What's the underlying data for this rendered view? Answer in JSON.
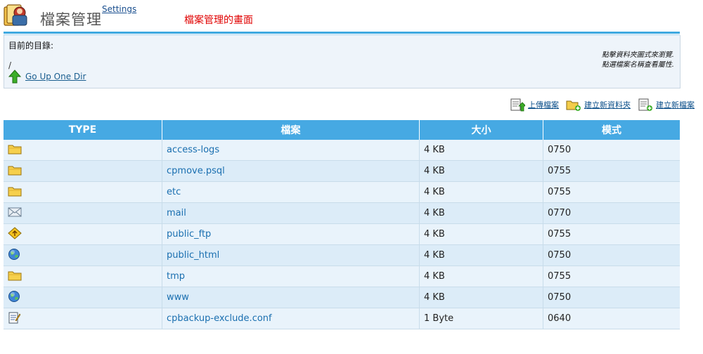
{
  "header": {
    "app_title": "檔案管理",
    "settings_label": "Settings",
    "page_heading": "檔案管理的畫面"
  },
  "dir": {
    "label": "目前的目錄:",
    "path": "/",
    "go_up_label": "Go Up One Dir",
    "hint_line1": "點擊資料夾圖式來瀏覽.",
    "hint_line2": "點選檔案名稱查看屬性."
  },
  "actions": {
    "upload": "上傳檔案",
    "new_folder": "建立新資料夾",
    "new_file": "建立新檔案"
  },
  "table": {
    "columns": [
      "TYPE",
      "檔案",
      "大小",
      "模式"
    ],
    "rows": [
      {
        "type": "folder-icon",
        "name": "access-logs",
        "size": "4 KB",
        "mode": "0750"
      },
      {
        "type": "folder-icon",
        "name": "cpmove.psql",
        "size": "4 KB",
        "mode": "0755"
      },
      {
        "type": "folder-icon",
        "name": "etc",
        "size": "4 KB",
        "mode": "0755"
      },
      {
        "type": "mail-icon",
        "name": "mail",
        "size": "4 KB",
        "mode": "0770"
      },
      {
        "type": "ftp-icon",
        "name": "public_ftp",
        "size": "4 KB",
        "mode": "0755"
      },
      {
        "type": "globe-icon",
        "name": "public_html",
        "size": "4 KB",
        "mode": "0750"
      },
      {
        "type": "folder-icon",
        "name": "tmp",
        "size": "4 KB",
        "mode": "0755"
      },
      {
        "type": "globe-icon",
        "name": "www",
        "size": "4 KB",
        "mode": "0750"
      },
      {
        "type": "text-file-icon",
        "name": "cpbackup-exclude.conf",
        "size": "1 Byte",
        "mode": "0640"
      }
    ]
  },
  "colors": {
    "header_blue": "#46a9e3",
    "heading_red": "#e00000",
    "link_blue": "#1a6fb0"
  }
}
